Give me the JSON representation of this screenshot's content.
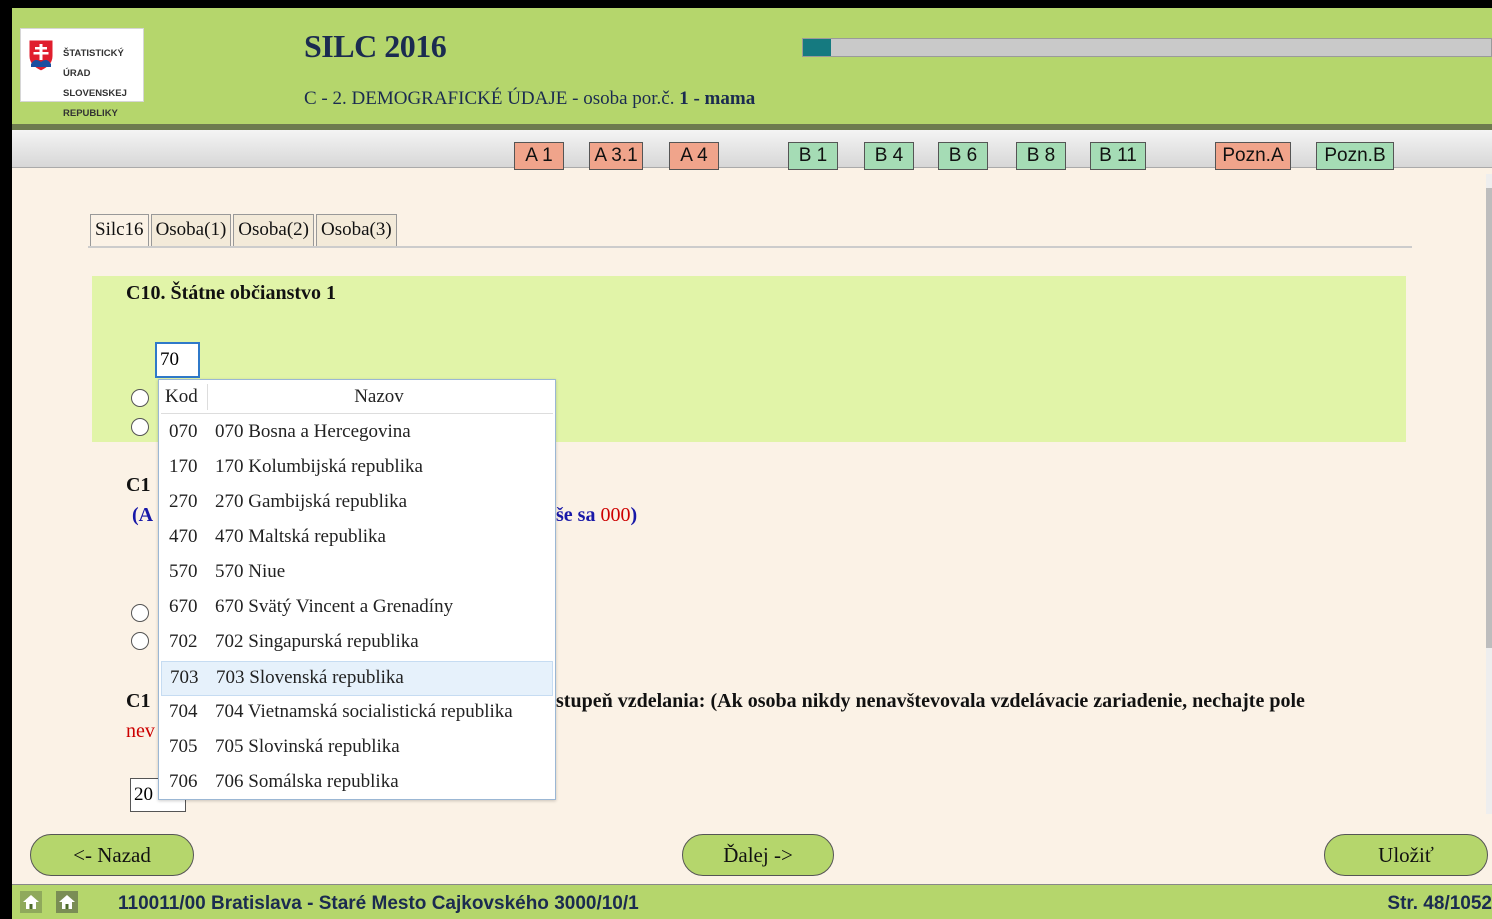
{
  "header": {
    "logo_lines": [
      "ŠTATISTICKÝ",
      "ÚRAD",
      "SLOVENSKEJ",
      "REPUBLIKY"
    ],
    "title": "SILC 2016",
    "subtitle_prefix": "C - 2. DEMOGRAFICKÉ ÚDAJE - osoba por.č. ",
    "subtitle_bold": "1 - mama",
    "progress_fraction": 0.04
  },
  "nav_buttons": [
    {
      "label": "A 1",
      "color": "#f0a48b"
    },
    {
      "label": "A 3.1",
      "color": "#f0a48b"
    },
    {
      "label": "A 4",
      "color": "#f0a48b"
    },
    {
      "label": "B 1",
      "color": "#a5dcb5"
    },
    {
      "label": "B 4",
      "color": "#a5dcb5"
    },
    {
      "label": "B 6",
      "color": "#a5dcb5"
    },
    {
      "label": "B 8",
      "color": "#a5dcb5"
    },
    {
      "label": "B 11",
      "color": "#a5dcb5"
    },
    {
      "label": "Pozn.A",
      "color": "#f0a48b"
    },
    {
      "label": "Pozn.B",
      "color": "#a5dcb5"
    }
  ],
  "tabs": [
    "Silc16",
    "Osoba(1)",
    "Osoba(2)",
    "Osoba(3)"
  ],
  "questions": {
    "c10_label": "C10. Štátne občianstvo 1",
    "c10_value": "70",
    "c11_visible": "C1",
    "c11_note_open": "(A",
    "c11_note_tail": "še sa ",
    "c11_note_code": "000",
    "c11_note_close": ")",
    "c12_visible": "C1",
    "c12_tail": "stupeň vzdelania: (Ak osoba nikdy nenavštevovala vzdelávacie zariadenie, nechajte pole",
    "c12_red": "nev",
    "c12_value": "20"
  },
  "dropdown": {
    "col_code": "Kod",
    "col_name": "Nazov",
    "items": [
      {
        "code": "070",
        "name": "070 Bosna a Hercegovina"
      },
      {
        "code": "170",
        "name": "170 Kolumbijská republika"
      },
      {
        "code": "270",
        "name": "270 Gambijská republika"
      },
      {
        "code": "470",
        "name": "470 Maltská republika"
      },
      {
        "code": "570",
        "name": "570 Niue"
      },
      {
        "code": "670",
        "name": "670 Svätý Vincent a Grenadíny"
      },
      {
        "code": "702",
        "name": "702 Singapurská republika"
      },
      {
        "code": "703",
        "name": "703 Slovenská republika"
      },
      {
        "code": "704",
        "name": "704 Vietnamská socialistická republika"
      },
      {
        "code": "705",
        "name": "705 Slovinská republika"
      },
      {
        "code": "706",
        "name": "706 Somálska republika"
      }
    ],
    "highlighted_code": "703"
  },
  "footer_buttons": {
    "back": "<- Nazad",
    "next": "Ďalej ->",
    "save": "Uložiť"
  },
  "status": {
    "address": "110011/00 Bratislava - Staré Mesto Cajkovského 3000/10/1",
    "page": "Str. 48/1052"
  }
}
